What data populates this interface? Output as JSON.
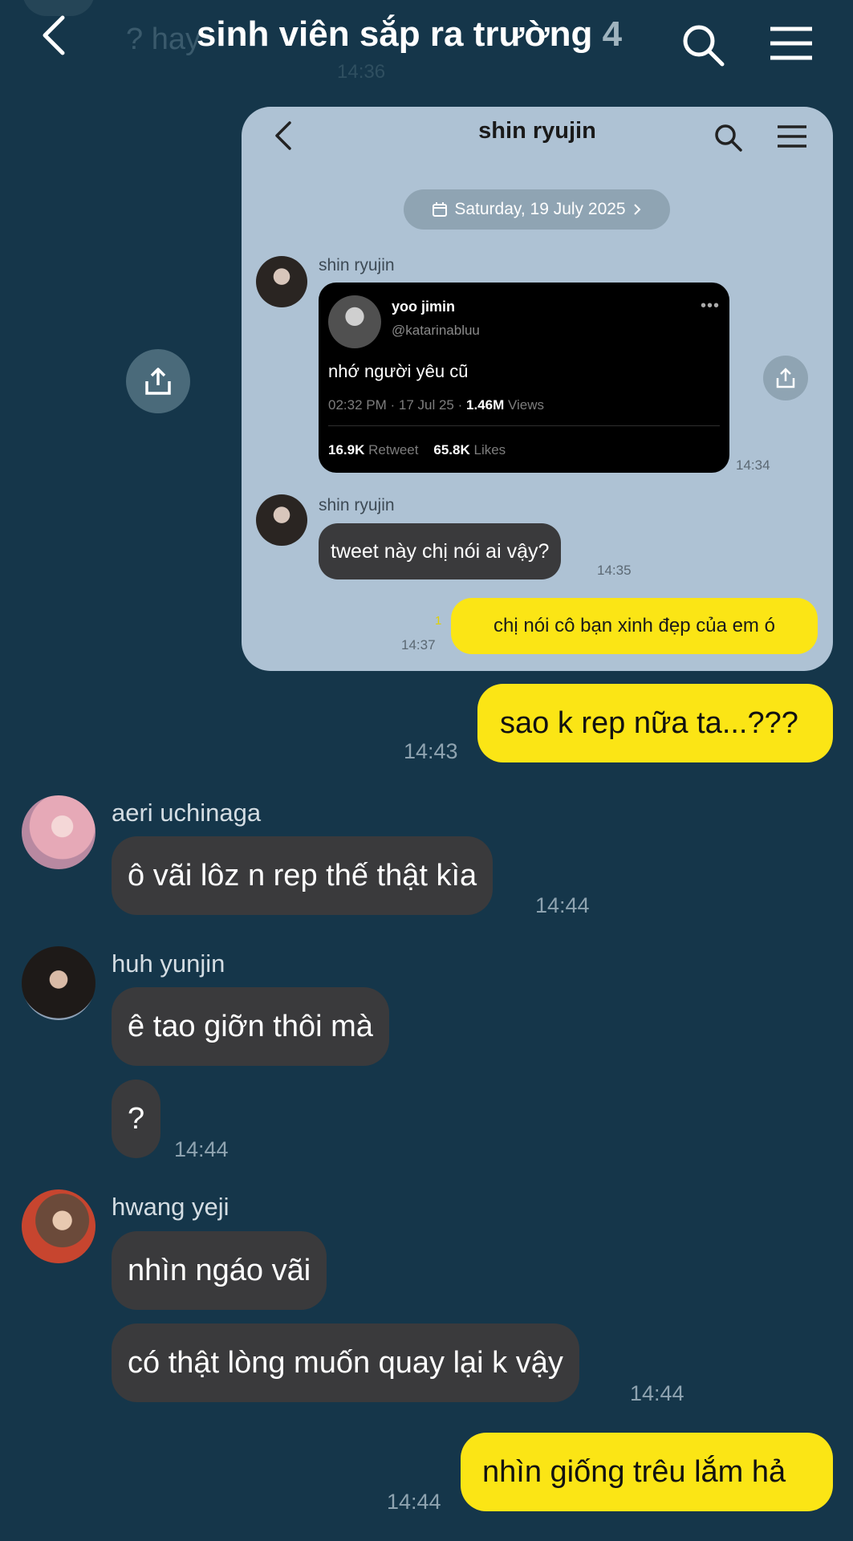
{
  "header": {
    "title": "sinh viên sắp ra trường",
    "member_count": "4",
    "prev_message_text": "? hay",
    "prev_message_time": "14:36"
  },
  "shared_screenshot": {
    "title": "shin ryujin",
    "date_label": "Saturday, 19 July 2025",
    "sender_1": "shin ryujin",
    "tweet": {
      "name": "yoo jimin",
      "handle": "@katarinabluu",
      "more": "•••",
      "text": "nhớ người yêu cũ",
      "time_date": "02:32 PM · 17 Jul 25 ·",
      "views_count": "1.46M",
      "views_label": "Views",
      "retweet_count": "16.9K",
      "retweet_label": "Retweet",
      "likes_count": "65.8K",
      "likes_label": "Likes"
    },
    "time_1": "14:34",
    "sender_2": "shin ryujin",
    "msg_2": "tweet này chị nói ai vậy?",
    "time_2": "14:35",
    "reply": "chị nói cô bạn xinh đẹp của em ó",
    "reply_read": "1",
    "reply_time": "14:37"
  },
  "messages": {
    "me_1": "sao k rep nữa ta...???",
    "me_1_time": "14:43",
    "aeri_name": "aeri uchinaga",
    "aeri_msg": "ô vãi lôz n rep thế thật kìa",
    "aeri_time": "14:44",
    "yunjin_name": "huh yunjin",
    "yunjin_msg_1": "ê tao giỡn thôi mà",
    "yunjin_msg_2": "?",
    "yunjin_time": "14:44",
    "yeji_name": "hwang yeji",
    "yeji_msg_1": "nhìn ngáo vãi",
    "yeji_msg_2": "có thật lòng muốn quay lại k vậy",
    "yeji_time": "14:44",
    "me_2": "nhìn giống trêu lắm hả",
    "me_2_time": "14:44"
  },
  "colors": {
    "background": "#15364a",
    "my_bubble": "#fbe515",
    "their_bubble": "#3a3a3c",
    "shared_card": "#aec2d4"
  },
  "icons": [
    "back-arrow-icon",
    "search-icon",
    "menu-icon",
    "share-icon",
    "calendar-icon",
    "chevron-right-icon"
  ]
}
